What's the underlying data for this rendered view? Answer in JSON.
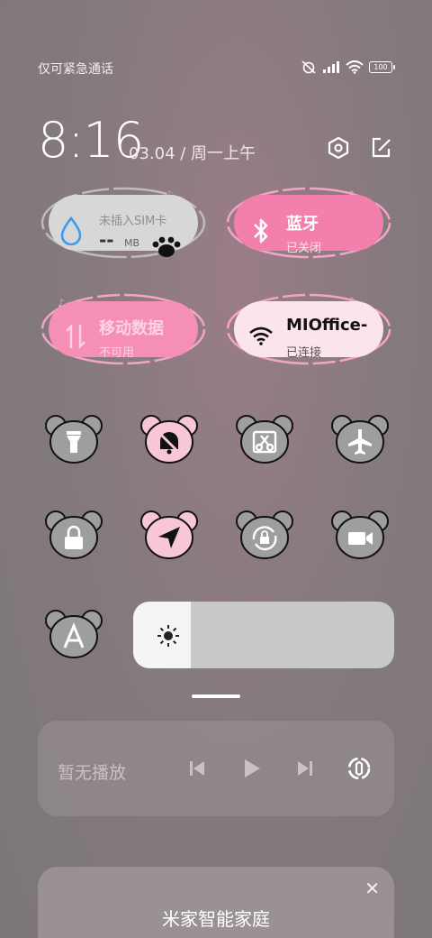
{
  "status_bar": {
    "carrier_text": "仅可紧急通话",
    "battery_level": "100",
    "icons": [
      "alarm-muted-icon",
      "signal-icon",
      "wifi-icon",
      "battery-icon"
    ]
  },
  "header": {
    "time": "8:16",
    "date": "03.04 / 周一上午",
    "icons": [
      "settings-hex-icon",
      "edit-icon"
    ]
  },
  "tiles": {
    "sim": {
      "title": "未插入SIM卡",
      "value": "--",
      "unit": "MB",
      "icon": "water-drop-icon"
    },
    "bluetooth": {
      "title": "蓝牙",
      "status": "已关闭",
      "icon": "bluetooth-icon"
    },
    "mobile_data": {
      "title": "移动数据",
      "status": "不可用",
      "icon": "data-arrows-icon"
    },
    "wifi": {
      "title": "MIOffice-",
      "status": "已连接",
      "icon": "wifi-icon"
    }
  },
  "toggles": [
    {
      "id": "flashlight",
      "icon": "flashlight-icon",
      "active": false
    },
    {
      "id": "silent",
      "icon": "bell-muted-icon",
      "active": true
    },
    {
      "id": "screenshot",
      "icon": "scissors-icon",
      "active": false
    },
    {
      "id": "airplane",
      "icon": "airplane-icon",
      "active": false
    },
    {
      "id": "lock",
      "icon": "lock-icon",
      "active": false
    },
    {
      "id": "location",
      "icon": "location-arrow-icon",
      "active": true
    },
    {
      "id": "rotation-lock",
      "icon": "rotation-lock-icon",
      "active": false
    },
    {
      "id": "screen-record",
      "icon": "video-camera-icon",
      "active": false
    },
    {
      "id": "auto-brightness",
      "icon": "letter-a-icon",
      "active": false
    }
  ],
  "brightness": {
    "level": 0.22,
    "icon": "sun-icon"
  },
  "media": {
    "label": "暂无播放",
    "icons": [
      "previous-icon",
      "play-icon",
      "next-icon",
      "cast-icon"
    ]
  },
  "smart_home": {
    "title": "米家智能家庭",
    "close_icon": "close-icon"
  },
  "colors": {
    "pink": "#f27fac",
    "pink_light": "#fce4ef",
    "gray_bear": "#9e9e9e",
    "bear_pink": "#f7c7d9",
    "outline_pink": "#f4a5c2"
  }
}
